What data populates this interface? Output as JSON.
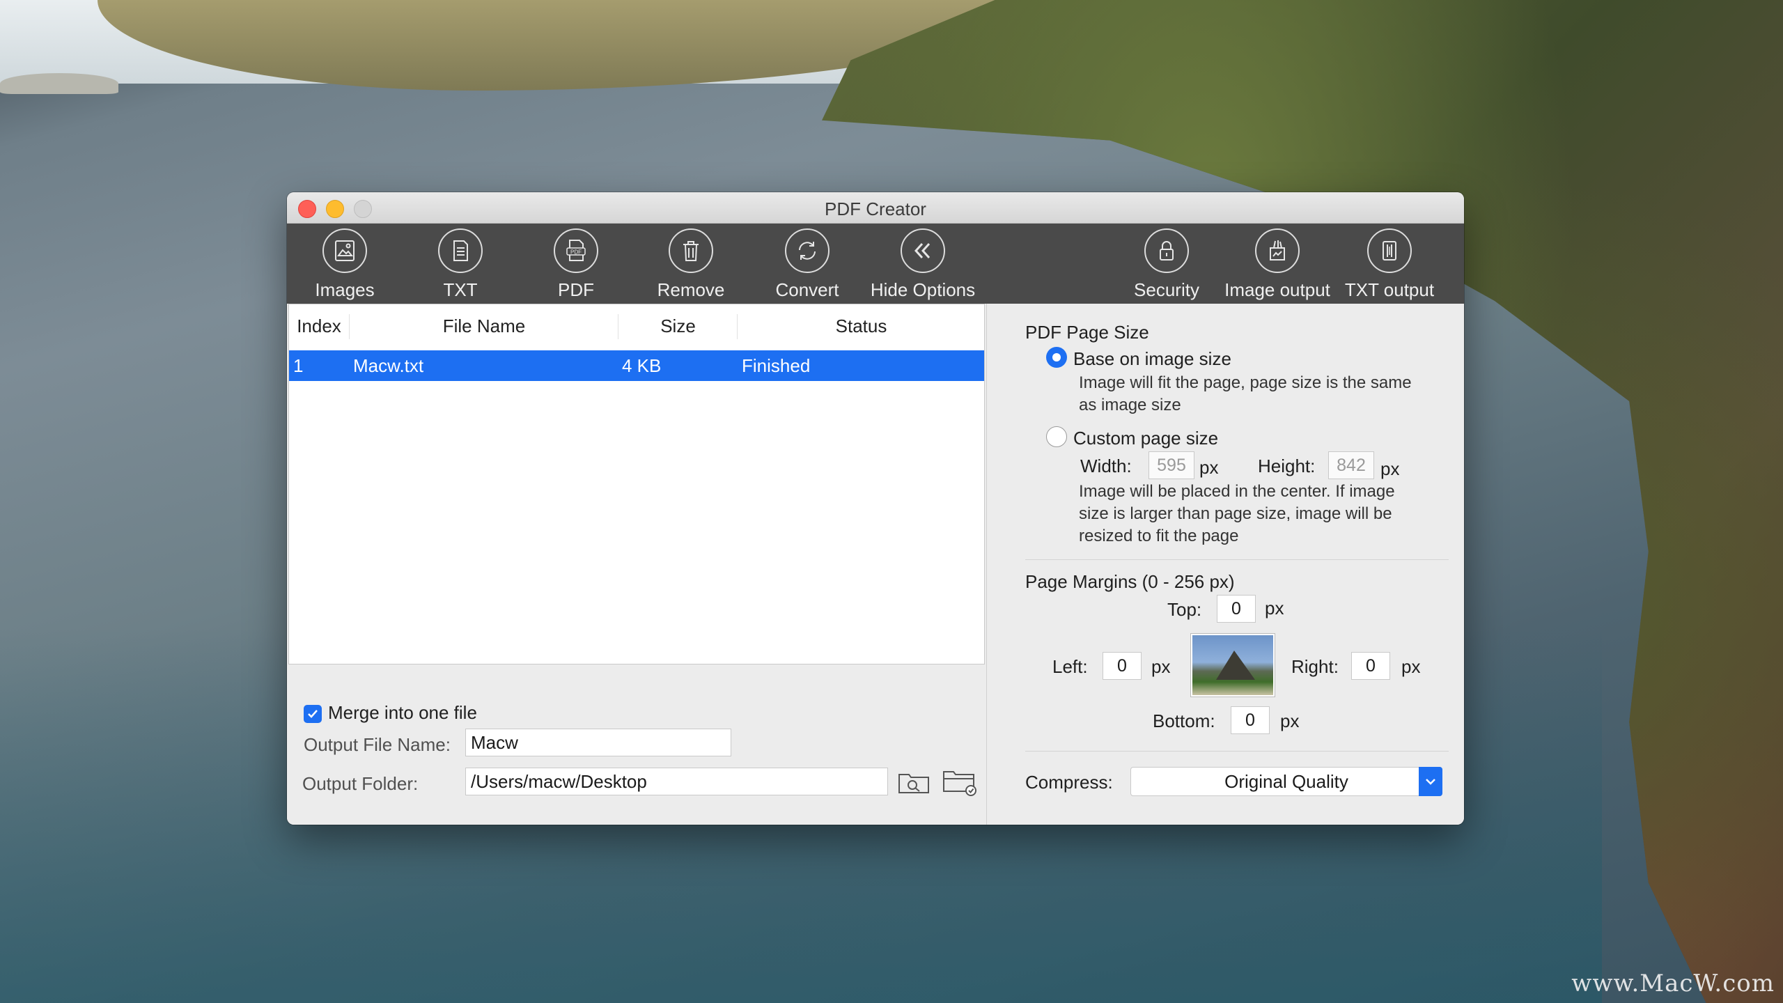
{
  "window": {
    "title": "PDF Creator"
  },
  "toolbar": {
    "images": "Images",
    "txt": "TXT",
    "pdf": "PDF",
    "remove": "Remove",
    "convert": "Convert",
    "hide_options": "Hide Options",
    "security": "Security",
    "image_output": "Image output",
    "txt_output": "TXT output"
  },
  "table": {
    "columns": [
      "Index",
      "File Name",
      "Size",
      "Status"
    ],
    "rows": [
      {
        "index": "1",
        "file_name": "Macw.txt",
        "size": "4 KB",
        "status": "Finished"
      }
    ]
  },
  "output": {
    "merge_label": "Merge into one file",
    "merge_checked": true,
    "file_name_label": "Output File Name:",
    "file_name_value": "Macw",
    "folder_label": "Output Folder:",
    "folder_value": "/Users/macw/Desktop"
  },
  "page_size": {
    "heading": "PDF Page Size",
    "base_label": "Base on image size",
    "base_note_1": "Image will fit the page, page size is the same",
    "base_note_2": "as image size",
    "custom_label": "Custom page size",
    "width_label": "Width:",
    "width_value": "595",
    "height_label": "Height:",
    "height_value": "842",
    "unit": "px",
    "custom_note_1": "Image will be placed in the center. If image",
    "custom_note_2": "size is larger than page size, image will be",
    "custom_note_3": "resized to fit the page",
    "selected": "base"
  },
  "margins": {
    "heading": "Page Margins (0 - 256 px)",
    "top_label": "Top:",
    "top_value": "0",
    "left_label": "Left:",
    "left_value": "0",
    "right_label": "Right:",
    "right_value": "0",
    "bottom_label": "Bottom:",
    "bottom_value": "0",
    "unit": "px"
  },
  "compress": {
    "label": "Compress:",
    "value": "Original Quality"
  },
  "watermark": "www.MacW.com",
  "colors": {
    "accent": "#1d6ff2",
    "toolbar": "#4a4a4a"
  }
}
